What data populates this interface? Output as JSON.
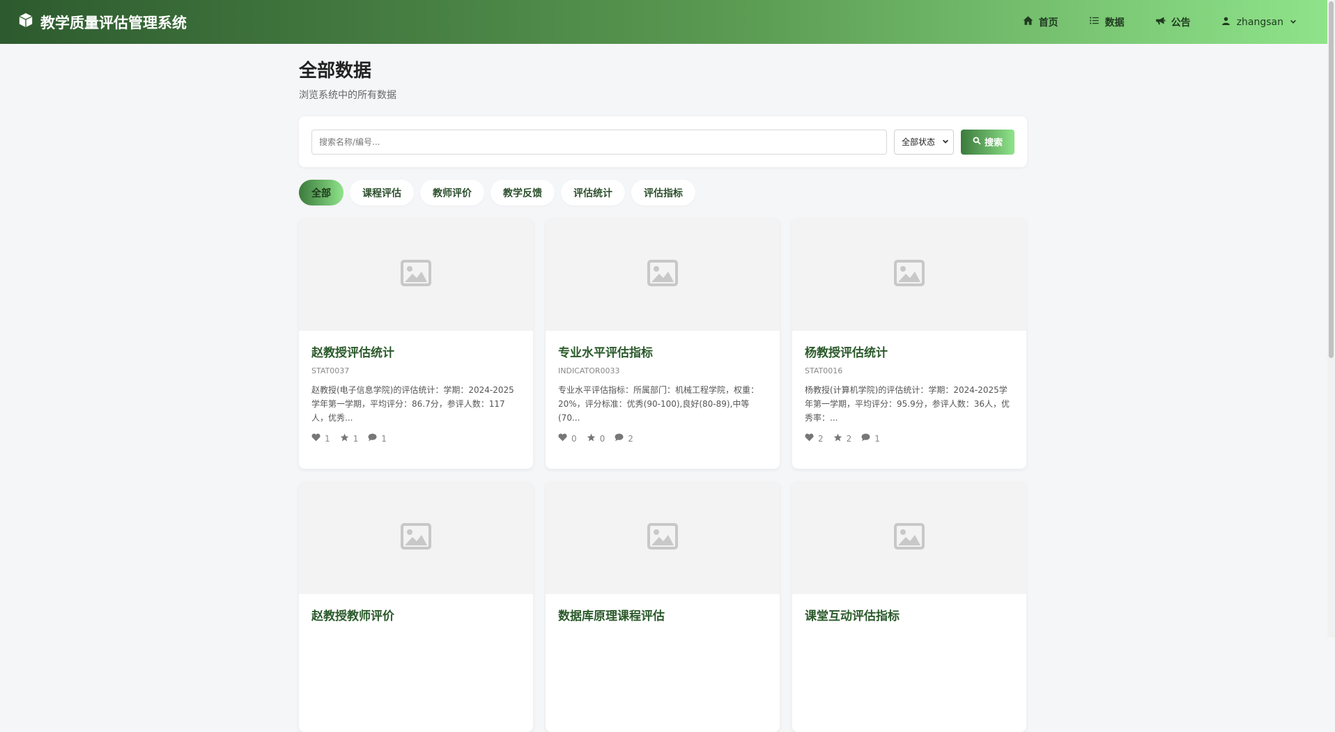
{
  "navbar": {
    "brand": "教学质量评估管理系统",
    "items": [
      {
        "label": "首页",
        "icon": "home-icon"
      },
      {
        "label": "数据",
        "icon": "list-icon"
      },
      {
        "label": "公告",
        "icon": "bullhorn-icon"
      }
    ],
    "user": "zhangsan"
  },
  "page": {
    "title": "全部数据",
    "subtitle": "浏览系统中的所有数据"
  },
  "search": {
    "placeholder": "搜索名称/编号...",
    "status_selected": "全部状态",
    "button_label": "搜索"
  },
  "tabs": [
    "全部",
    "课程评估",
    "教师评价",
    "教学反馈",
    "评估统计",
    "评估指标"
  ],
  "cards": [
    {
      "title": "赵教授评估统计",
      "code": "STAT0037",
      "desc": "赵教授(电子信息学院)的评估统计：学期：2024-2025学年第一学期，平均评分：86.7分，参评人数：117人，优秀...",
      "likes": "1",
      "favs": "1",
      "comments": "1"
    },
    {
      "title": "专业水平评估指标",
      "code": "INDICATOR0033",
      "desc": "专业水平评估指标：所属部门：机械工程学院，权重：20%，评分标准：优秀(90-100),良好(80-89),中等(70...",
      "likes": "0",
      "favs": "0",
      "comments": "2"
    },
    {
      "title": "杨教授评估统计",
      "code": "STAT0016",
      "desc": "杨教授(计算机学院)的评估统计：学期：2024-2025学年第一学期，平均评分：95.9分，参评人数：36人，优秀率：...",
      "likes": "2",
      "favs": "2",
      "comments": "1"
    },
    {
      "title": "赵教授教师评价",
      "code": "",
      "desc": "",
      "likes": "",
      "favs": "",
      "comments": ""
    },
    {
      "title": "数据库原理课程评估",
      "code": "",
      "desc": "",
      "likes": "",
      "favs": "",
      "comments": ""
    },
    {
      "title": "课堂互动评估指标",
      "code": "",
      "desc": "",
      "likes": "",
      "favs": "",
      "comments": ""
    }
  ]
}
